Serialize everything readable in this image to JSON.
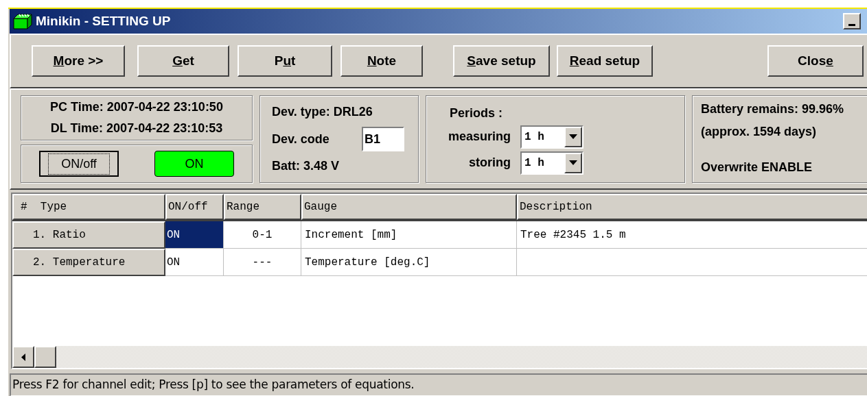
{
  "window": {
    "title": "Minikin - SETTING UP"
  },
  "toolbar": [
    {
      "key": "M",
      "after": "ore >>"
    },
    {
      "key": "G",
      "after": "et"
    },
    {
      "before": "P",
      "key": "u",
      "after": "t"
    },
    {
      "key": "N",
      "after": "ote"
    },
    {
      "key": "S",
      "after": "ave setup"
    },
    {
      "key": "R",
      "after": "ead setup"
    },
    {
      "before": "Clos",
      "key": "e"
    }
  ],
  "clock": {
    "pc_time": "PC Time: 2007-04-22 23:10:50",
    "dl_time": "DL Time: 2007-04-22 23:10:53",
    "toggle_button": "ON/off",
    "status": {
      "label": "ON",
      "on": true
    }
  },
  "device": {
    "type": "Dev. type: DRL26",
    "code_label": "Dev. code",
    "code_value": "B1",
    "batt": "Batt: 3.48 V"
  },
  "periods": {
    "title": "Periods :",
    "items": [
      {
        "label": "measuring",
        "value": "1 h"
      },
      {
        "label": "storing",
        "value": "1 h"
      }
    ]
  },
  "battery": {
    "remains": "Battery remains: 99.96%",
    "approx": "(approx. 1594 days)",
    "overwrite": "Overwrite ENABLE"
  },
  "table": {
    "columns": [
      "#  Type",
      "ON/off",
      "Range",
      "Gauge",
      "Description"
    ],
    "rows": [
      {
        "type": "1. Ratio",
        "on_off": {
          "text": "ON",
          "selected": true
        },
        "range": "0-1",
        "gauge": "Increment [mm]",
        "description": "Tree #2345 1.5 m"
      },
      {
        "type": "2. Temperature",
        "on_off": {
          "text": "ON",
          "selected": false
        },
        "range": "---",
        "gauge": "Temperature [deg.C]"
      }
    ]
  },
  "status_bar": "Press F2 for channel edit; Press [p] to see the parameters of equations."
}
